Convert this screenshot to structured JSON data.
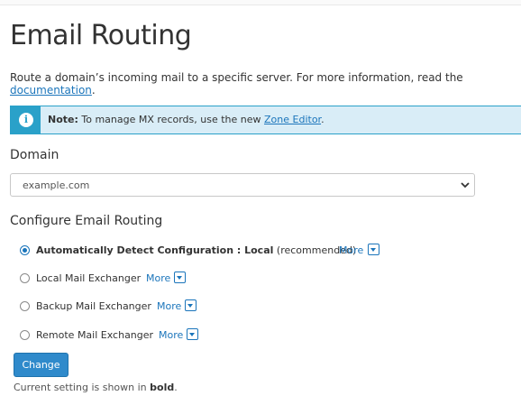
{
  "page": {
    "title": "Email Routing",
    "intro_text": "Route a domain’s incoming mail to a specific server. For more information, read the ",
    "intro_link": "documentation",
    "intro_end": "."
  },
  "note": {
    "icon": "info-icon",
    "icon_glyph": "i",
    "bold": "Note:",
    "text": " To manage MX records, use the new ",
    "link": "Zone Editor",
    "end": "."
  },
  "domain": {
    "label": "Domain",
    "selected": "example.com"
  },
  "routing": {
    "heading": "Configure Email Routing",
    "more_label": "More",
    "options": [
      {
        "label_bold": "Automatically Detect Configuration : Local",
        "label_rest": " (recommended)",
        "checked": true
      },
      {
        "label": "Local Mail Exchanger",
        "checked": false
      },
      {
        "label": "Backup Mail Exchanger",
        "checked": false
      },
      {
        "label": "Remote Mail Exchanger",
        "checked": false
      }
    ]
  },
  "actions": {
    "change_label": "Change"
  },
  "footnote": {
    "before": "Current setting is shown in ",
    "bold": "bold",
    "after": "."
  },
  "colors": {
    "link": "#1b75bb",
    "note_bg": "#d9edf7",
    "note_accent": "#2aa1c9",
    "button": "#2f8acb"
  }
}
